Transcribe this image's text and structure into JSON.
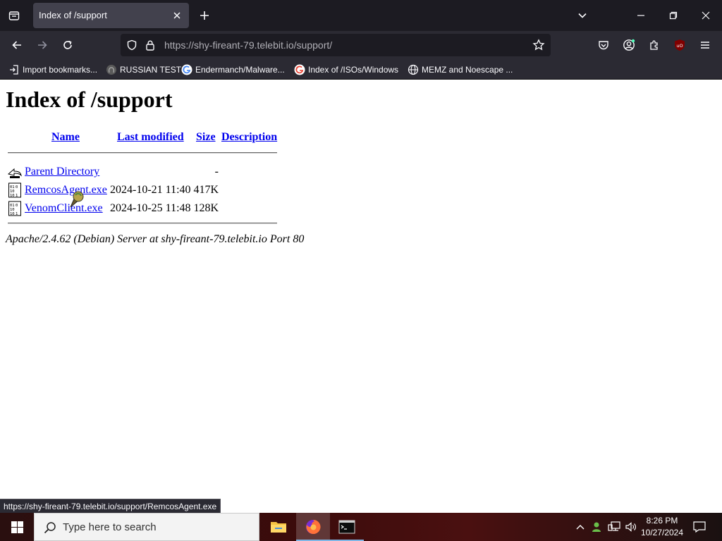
{
  "browser": {
    "tab_title": "Index of /support",
    "url_host": "https://shy-fireant-79.telebit.io",
    "url_path": "/support/",
    "url_full": "https://shy-fireant-79.telebit.io/support/"
  },
  "bookmarks": [
    {
      "label": "Import bookmarks...",
      "icon": "import-icon"
    },
    {
      "label": "RUSSIAN TEST",
      "icon": "github-icon"
    },
    {
      "label": "Endermanch/Malware...",
      "icon": "google-icon"
    },
    {
      "label": "Index of /ISOs/Windows",
      "icon": "google-icon"
    },
    {
      "label": "MEMZ and Noescape ...",
      "icon": "globe-icon"
    }
  ],
  "page": {
    "title": "Index of /support",
    "headers": {
      "name": "Name",
      "modified": "Last modified",
      "size": "Size",
      "description": "Description"
    },
    "rows": [
      {
        "name": "Parent Directory",
        "modified": "",
        "size": "-",
        "icon": "back-folder-icon"
      },
      {
        "name": "RemcosAgent.exe",
        "modified": "2024-10-21 11:40",
        "size": "417K",
        "icon": "binary-file-icon"
      },
      {
        "name": "VenomClient.exe",
        "modified": "2024-10-25 11:48",
        "size": "128K",
        "icon": "binary-file-icon"
      }
    ],
    "server_signature": "Apache/2.4.62 (Debian) Server at shy-fireant-79.telebit.io Port 80"
  },
  "status_url": "https://shy-fireant-79.telebit.io/support/RemcosAgent.exe",
  "taskbar": {
    "search_placeholder": "Type here to search",
    "time": "8:26 PM",
    "date": "10/27/2024"
  },
  "colors": {
    "link": "#0000ee",
    "chrome_dark": "#1c1b22",
    "chrome_mid": "#2b2a33",
    "ublock_red": "#800000"
  }
}
